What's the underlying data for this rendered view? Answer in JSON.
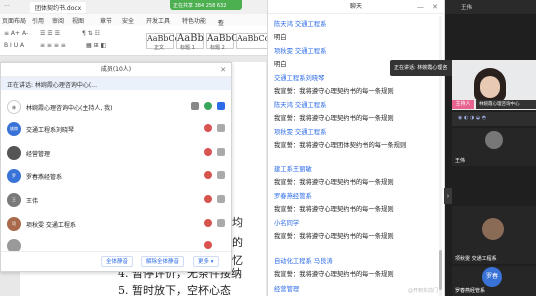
{
  "doc": {
    "tab_title": "团体契约书.docx",
    "menu": [
      "页面布局",
      "引用",
      "审阅",
      "视图",
      "章节",
      "安全",
      "开发工具",
      "特色功能"
    ],
    "active_menu": "开始",
    "search_label": "查找",
    "styles": [
      {
        "preview": "AaBbCcDd",
        "label": "正文"
      },
      {
        "preview": "AaBb",
        "label": "标题 1"
      },
      {
        "preview": "AaBbC",
        "label": "标题 2"
      },
      {
        "preview": "AaBbCc",
        "label": ""
      }
    ],
    "lines": [
      "4. 暂停评价，无条件接纳",
      "5. 暂时放下，空杯心态"
    ],
    "side_chars": [
      "均",
      "的",
      "忆"
    ]
  },
  "share_indicator": "正在共享 384 258 632",
  "members": {
    "title": "成员(10人)",
    "speaking": "正在讲话: 林婉霞心理咨询中心(...",
    "items": [
      {
        "avatar": "林",
        "name": "林婉霞心理咨询中心(主持人, 我)",
        "color": "#ffffff"
      },
      {
        "avatar": "姚赫",
        "name": "交通工程系刘晓琴",
        "color": "#3a73d8"
      },
      {
        "avatar": "",
        "name": "经营管理",
        "color": "#555555"
      },
      {
        "avatar": "罗",
        "name": "罗春燕经管系",
        "color": "#3a73d8"
      },
      {
        "avatar": "王",
        "name": "王伟",
        "color": "#7a7a7a"
      },
      {
        "avatar": "项",
        "name": "项秋雯 交通工程系",
        "color": "#a86a4a"
      },
      {
        "avatar": "",
        "name": "",
        "color": "#999999"
      }
    ],
    "buttons": {
      "mute_all": "全体静音",
      "unmute_all": "解除全体静音",
      "more": "更多 ▾"
    }
  },
  "chat": {
    "title": "聊天",
    "messages": [
      {
        "name": "陈天鸿 交通工程系",
        "text": "明白"
      },
      {
        "name": "项秋雯 交通工程系",
        "text": "明白"
      },
      {
        "name": "交通工程系刘晓琴",
        "text": "我宣誓：我将遵守心理契约书的每一条规则"
      },
      {
        "name": "陈天鸿 交通工程系",
        "text": "我宣誓：我将遵守心理契约书的每一条规则"
      },
      {
        "name": "项秋雯 交通工程系",
        "text": "我宣誓：我将遵守心理团体契约书的每一条规则"
      },
      {
        "name": "建工系王丽敏",
        "text": "我宣誓：我将遵守心理契约书的每一条规则"
      },
      {
        "name": "罗春燕经管系",
        "text": "我宣誓：我将遵守心理契约书的每一条规则"
      },
      {
        "name": "小名同学",
        "text": "我宣誓：我将遵守心理契约书的每一条规则"
      },
      {
        "name": "自动化工程系 马良涛",
        "text": "我宣誓：我将遵守心理契约书的每一条规则"
      },
      {
        "name": "经营管理",
        "text": ""
      }
    ],
    "footer": "@开到东前门"
  },
  "gallery": {
    "top_label": "王伟",
    "speaking_tip": "正在讲话: 林婉霞心理咨",
    "host_tag": "主持人",
    "host_bar": "林婉霞心理咨询中心",
    "tiles": [
      {
        "name": "王伟",
        "avatar": ""
      },
      {
        "name": "项秋雯 交通工程系",
        "avatar": ""
      },
      {
        "name": "罗春燕经管系",
        "avatar": "罗春"
      }
    ]
  }
}
